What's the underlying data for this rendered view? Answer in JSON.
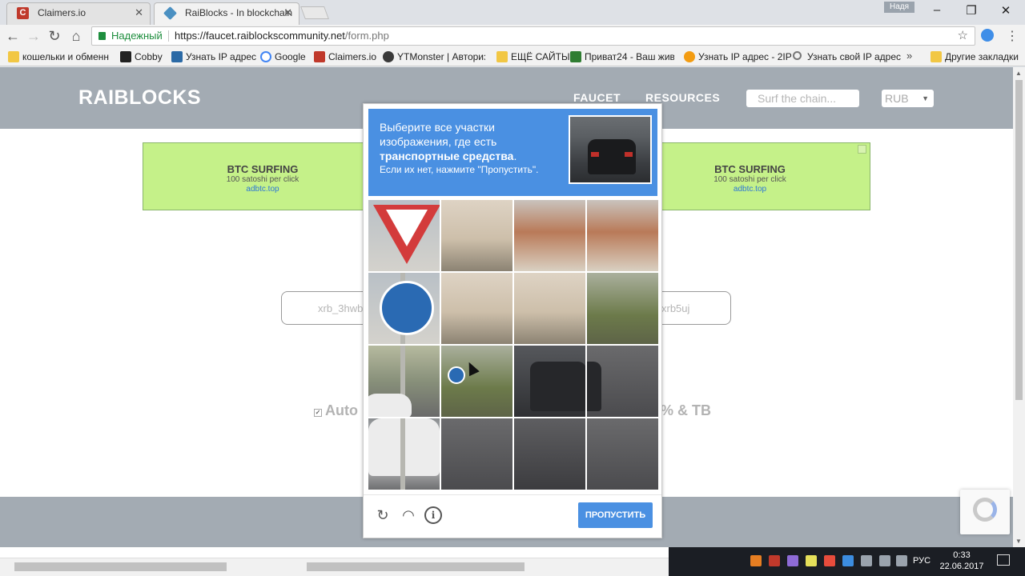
{
  "browser": {
    "tabs": [
      {
        "title": "Claimers.io",
        "close": "✕"
      },
      {
        "title": "RaiBlocks - In blockchain",
        "close": "✕"
      }
    ],
    "window_user": "Надя",
    "secure_label": "Надежный",
    "url_host": "https://faucet.raiblockscommunity.net",
    "url_path": "/form.php",
    "bookmarks": [
      "кошельки и обменн",
      "Cobby",
      "Узнать IP адрес",
      "Google",
      "Claimers.io",
      "YTMonster | Авториз",
      "ЕЩЁ САЙТЫ",
      "Приват24 - Ваш жив",
      "Узнать IP адрес - 2IP",
      "Узнать свой IP адрес",
      "Другие закладки"
    ]
  },
  "site": {
    "logo": "RAIBLOCKS",
    "nav": [
      "FAUCET",
      "RESOURCES"
    ],
    "search_placeholder": "Surf the chain...",
    "currency": "RUB",
    "ads": [
      {
        "title": "BTC SURFING",
        "subtitle": "100 satoshi per click",
        "link": "adbtc.top"
      },
      {
        "title": "BTC SURFING",
        "subtitle": "100 satoshi per click",
        "link": "adbtc.top"
      }
    ],
    "address_left": "xrb_3hwb",
    "address_right": "xrb5uj",
    "auto_label": "Auto",
    "tb_label": "% & TB"
  },
  "captcha": {
    "instruction_line1": "Выберите все участки изображения, где есть",
    "instruction_bold": "транспортные средства",
    "instruction_end": ".",
    "hint": "Если их нет, нажмите \"Пропустить\".",
    "skip_label": "ПРОПУСТИТЬ"
  },
  "taskbar": {
    "lang": "РУС",
    "time": "0:33",
    "date": "22.06.2017"
  }
}
